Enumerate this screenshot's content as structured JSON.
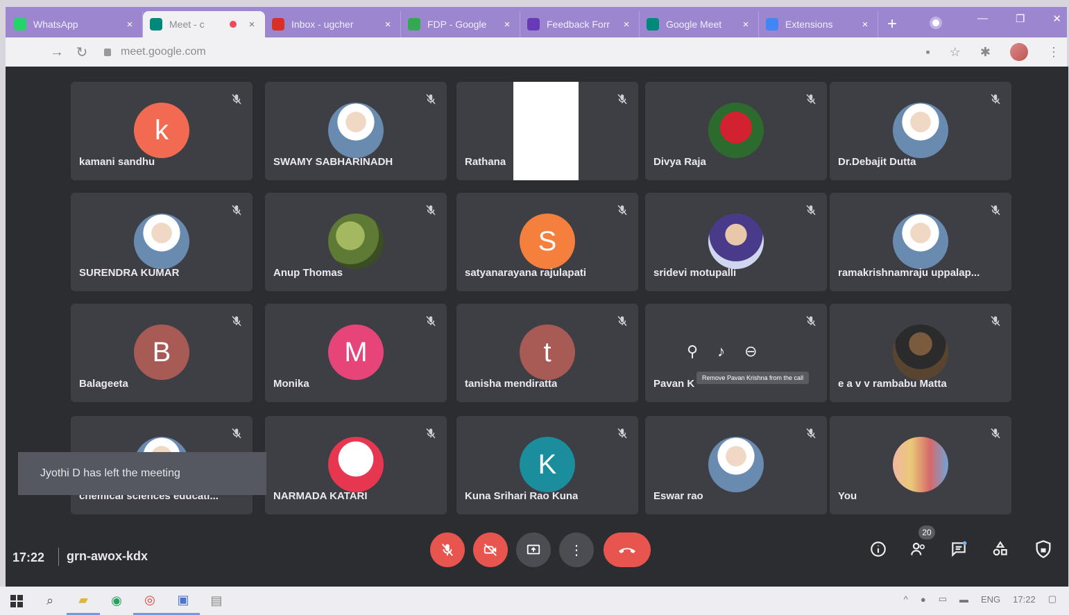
{
  "browser": {
    "tabs": [
      {
        "title": "WhatsApp",
        "icon": "whatsapp-icon",
        "color": "#25d366"
      },
      {
        "title": "Meet - c",
        "icon": "meet-icon",
        "color": "#00897b",
        "active": true
      },
      {
        "title": "Inbox - ugcher",
        "icon": "gmail-icon",
        "color": "#d93025"
      },
      {
        "title": "FDP - Google",
        "icon": "drive-icon",
        "color": "#34a853"
      },
      {
        "title": "Feedback Forr",
        "icon": "forms-icon",
        "color": "#673ab7"
      },
      {
        "title": "Google Meet",
        "icon": "meet-icon",
        "color": "#00897b"
      },
      {
        "title": "Extensions",
        "icon": "extensions-icon",
        "color": "#4285f4"
      }
    ],
    "new_tab": "+",
    "url": "meet.google.com"
  },
  "meet": {
    "tiles": [
      {
        "name": "kamani sandhu",
        "initial": "k",
        "color": "#f26a51"
      },
      {
        "name": "SWAMY SABHARINADH",
        "photo": "photo"
      },
      {
        "name": "Rathana",
        "blocked": true
      },
      {
        "name": "Divya Raja",
        "photo": "photo rose"
      },
      {
        "name": "Dr.Debajit Dutta",
        "photo": "photo"
      },
      {
        "name": "SURENDRA KUMAR",
        "photo": "photo"
      },
      {
        "name": "Anup Thomas",
        "photo": "photo nature"
      },
      {
        "name": "satyanarayana rajulapati",
        "initial": "S",
        "color": "#f5803e"
      },
      {
        "name": "sridevi motupalli",
        "photo": "photo woman"
      },
      {
        "name": "ramakrishnamraju uppalap...",
        "photo": "photo"
      },
      {
        "name": "Balageeta",
        "initial": "B",
        "color": "#a85a55"
      },
      {
        "name": "Monika",
        "initial": "M",
        "color": "#e6457a"
      },
      {
        "name": "tanisha mendiratta",
        "initial": "t",
        "color": "#a85a55"
      },
      {
        "name": "Pavan K",
        "hover": true,
        "tooltip": "Remove Pavan Krishna from the call"
      },
      {
        "name": "e a v v rambabu Matta",
        "photo": "photo man"
      },
      {
        "name": "chemical sciences educati...",
        "photo": "photo"
      },
      {
        "name": "NARMADA KATARI",
        "photo": "photo baby"
      },
      {
        "name": "Kuna Srihari Rao Kuna",
        "initial": "K",
        "color": "#1b8e9e"
      },
      {
        "name": "Eswar rao",
        "photo": "photo"
      },
      {
        "name": "You",
        "photo": "photo family"
      }
    ],
    "toast": "Jyothi D has left the meeting",
    "clock": "17:22",
    "meeting_code": "grn-awox-kdx",
    "participants_count": "20"
  },
  "taskbar": {
    "lang": "ENG",
    "time": "17:22"
  }
}
